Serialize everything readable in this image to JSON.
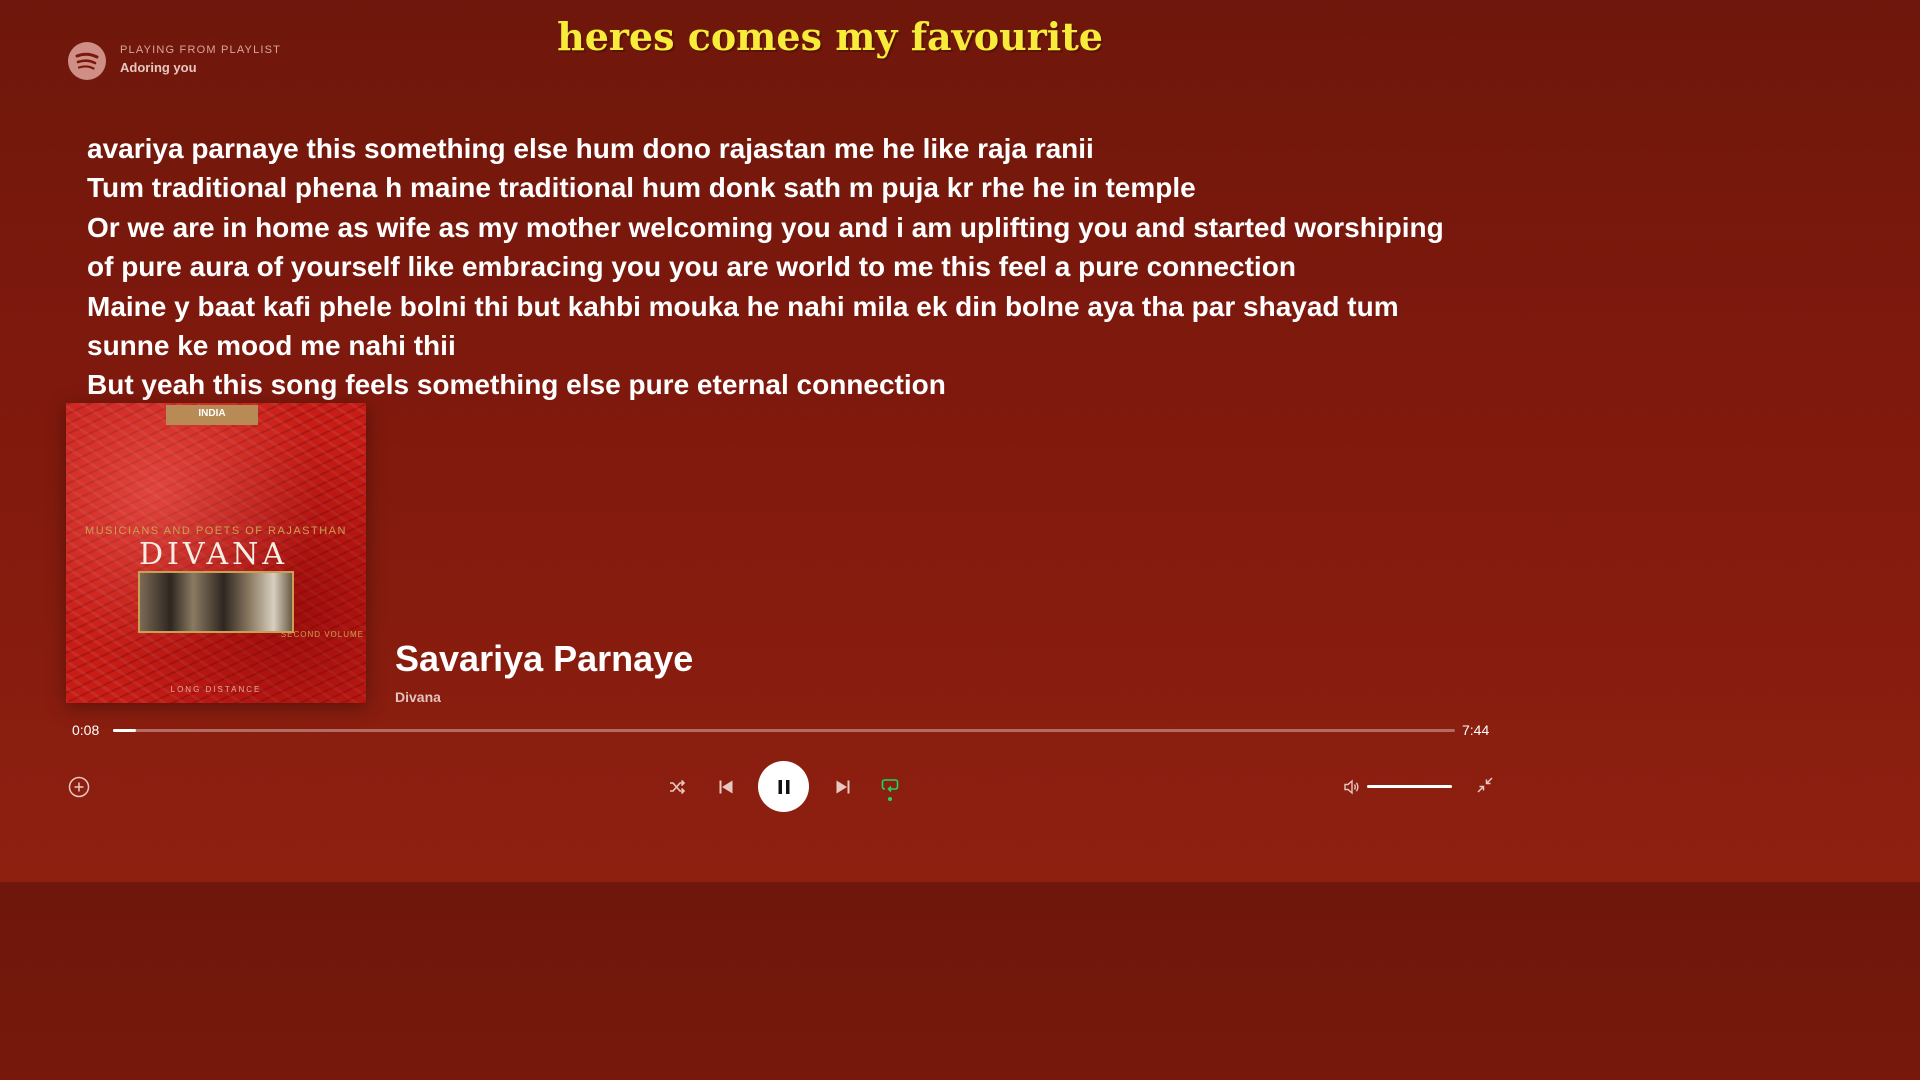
{
  "header": {
    "logo_icon": "spotify-logo-icon",
    "playlist_caption": "PLAYING FROM PLAYLIST",
    "playlist_name": "Adoring you",
    "banner_title": "heres comes my favourite"
  },
  "lyrics": {
    "lines": [
      "avariya parnaye this something else hum dono rajastan me he like raja ranii",
      "Tum traditional phena h maine traditional hum donk sath m puja kr rhe he in temple",
      "Or we are in home as wife as my mother welcoming you and i am uplifting you and started worshiping",
      "of pure aura of yourself like embracing you you are world to me this feel a pure connection",
      "Maine y baat kafi phele bolni thi but kahbi mouka he nahi mila ek din bolne aya tha par shayad tum",
      "sunne ke mood me nahi thii",
      "But yeah this song feels something else pure eternal connection"
    ]
  },
  "album": {
    "tag": "INDIA",
    "subtitle": "MUSICIANS AND POETS OF RAJASTHAN",
    "title": "DIVANA",
    "volume": "SECOND VOLUME",
    "label": "LONG DISTANCE"
  },
  "track": {
    "title": "Savariya Parnaye",
    "artist": "Divana"
  },
  "playback": {
    "elapsed": "0:08",
    "duration": "7:44",
    "progress_fraction": 0.017,
    "volume_fraction": 1.0,
    "shuffle_icon": "shuffle-icon",
    "previous_icon": "skip-previous-icon",
    "play_state_icon": "pause-icon",
    "next_icon": "skip-next-icon",
    "repeat_icon": "repeat-icon",
    "repeat_active": true
  },
  "colors": {
    "background": "#7a180c",
    "banner_text": "#f8ec3a",
    "accent_green": "#1ed760"
  }
}
